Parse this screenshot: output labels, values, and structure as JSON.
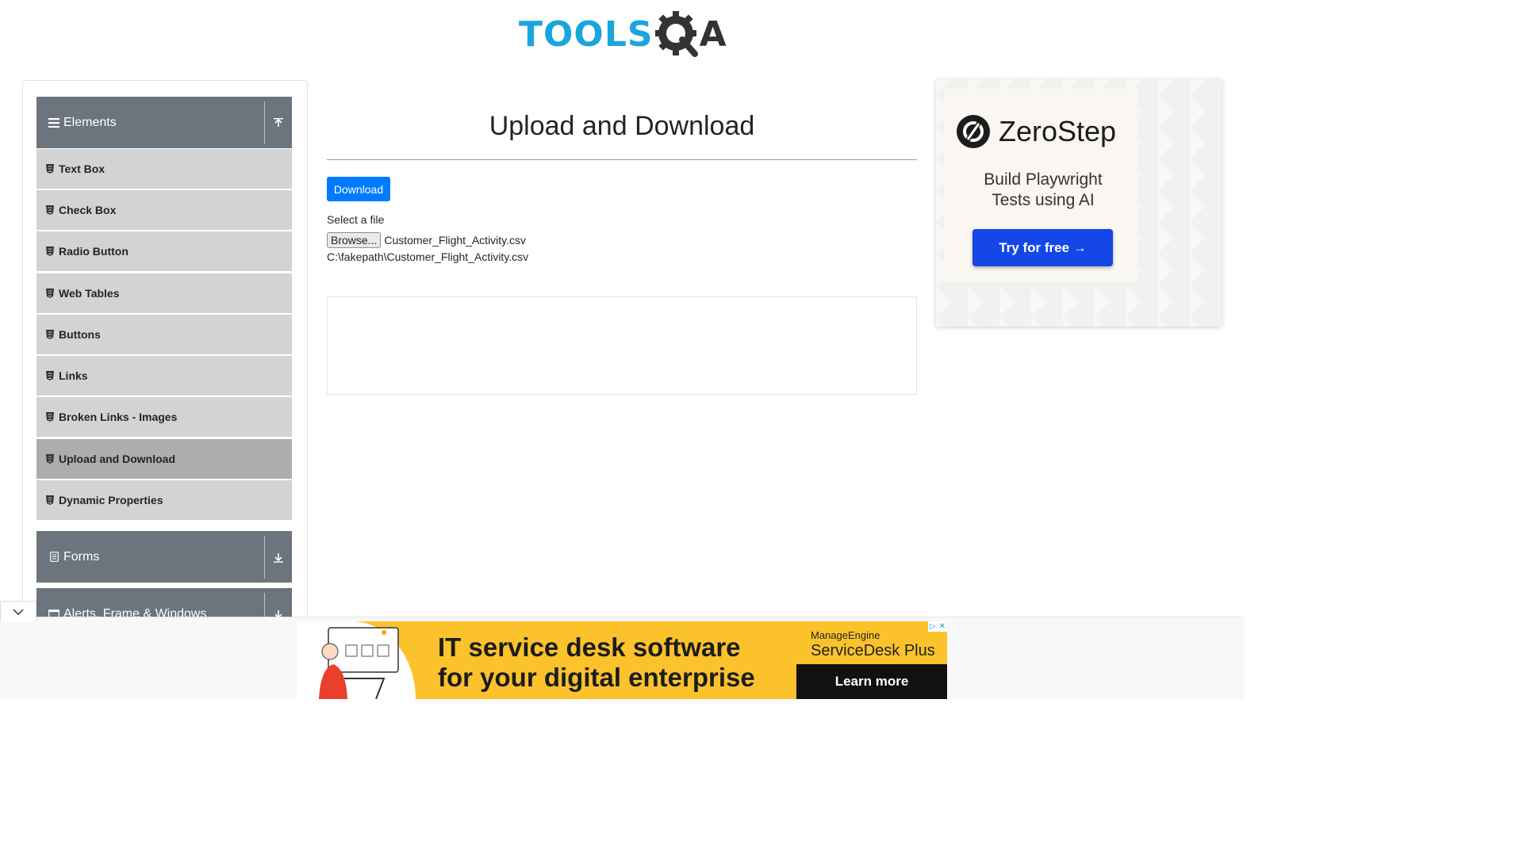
{
  "header": {
    "logo_tools": "TOOLS",
    "logo_a": "A",
    "colors": {
      "tools_blue": "#1aa6dc",
      "dark": "#333333"
    }
  },
  "sidebar": {
    "groups": [
      {
        "label": "Elements",
        "icon": "hamburger-icon",
        "toggle_icon": "upload-arrow-icon",
        "expanded": true
      },
      {
        "label": "Forms",
        "icon": "form-icon",
        "toggle_icon": "download-arrow-icon",
        "expanded": false
      },
      {
        "label": "Alerts, Frame & Windows",
        "icon": "window-icon",
        "toggle_icon": "download-arrow-icon",
        "expanded": false
      }
    ],
    "items": [
      {
        "label": "Text Box"
      },
      {
        "label": "Check Box"
      },
      {
        "label": "Radio Button"
      },
      {
        "label": "Web Tables"
      },
      {
        "label": "Buttons"
      },
      {
        "label": "Links"
      },
      {
        "label": "Broken Links - Images"
      },
      {
        "label": "Upload and Download",
        "active": true
      },
      {
        "label": "Dynamic Properties"
      }
    ],
    "colors": {
      "header_bg": "#6c757d",
      "item_bg": "#d3d3d3",
      "active_bg": "#adadad"
    }
  },
  "main": {
    "title": "Upload and Download",
    "download_label": "Download",
    "select_label": "Select a file",
    "browse_label": "Browse...",
    "selected_file": "Customer_Flight_Activity.csv",
    "uploaded_path": "C:\\fakepath\\Customer_Flight_Activity.csv",
    "colors": {
      "primary": "#007bff"
    }
  },
  "ad_right": {
    "brand": "ZeroStep",
    "tagline_line1": "Build Playwright",
    "tagline_line2": "Tests using AI",
    "cta": "Try for free →",
    "colors": {
      "cta_bg": "#1546e8"
    }
  },
  "ad_bottom": {
    "headline_line1": "IT service desk software",
    "headline_line2": "for your digital enterprise",
    "brand_line1": "ManageEngine",
    "brand_line2": "ServiceDesk Plus",
    "cta": "Learn more",
    "colors": {
      "bg": "#fbc22b"
    }
  }
}
